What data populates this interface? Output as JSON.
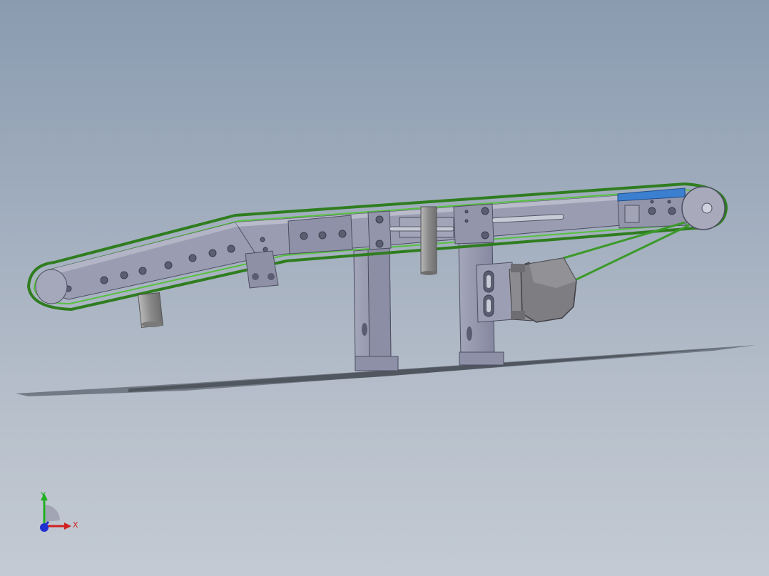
{
  "viewport": {
    "background_top": "#8a9bb0",
    "background_bottom": "#c3cad3"
  },
  "model": {
    "part_color": "#9799ad",
    "part_shade": "#7e8096",
    "belt_color": "#3c9a2a",
    "motor_color": "#86868a",
    "accent_blue": "#3b7fd0"
  },
  "triad": {
    "x_label": "X",
    "y_label": "Y",
    "x_color": "#d02020",
    "y_color": "#20b020",
    "z_color": "#2030d0"
  }
}
